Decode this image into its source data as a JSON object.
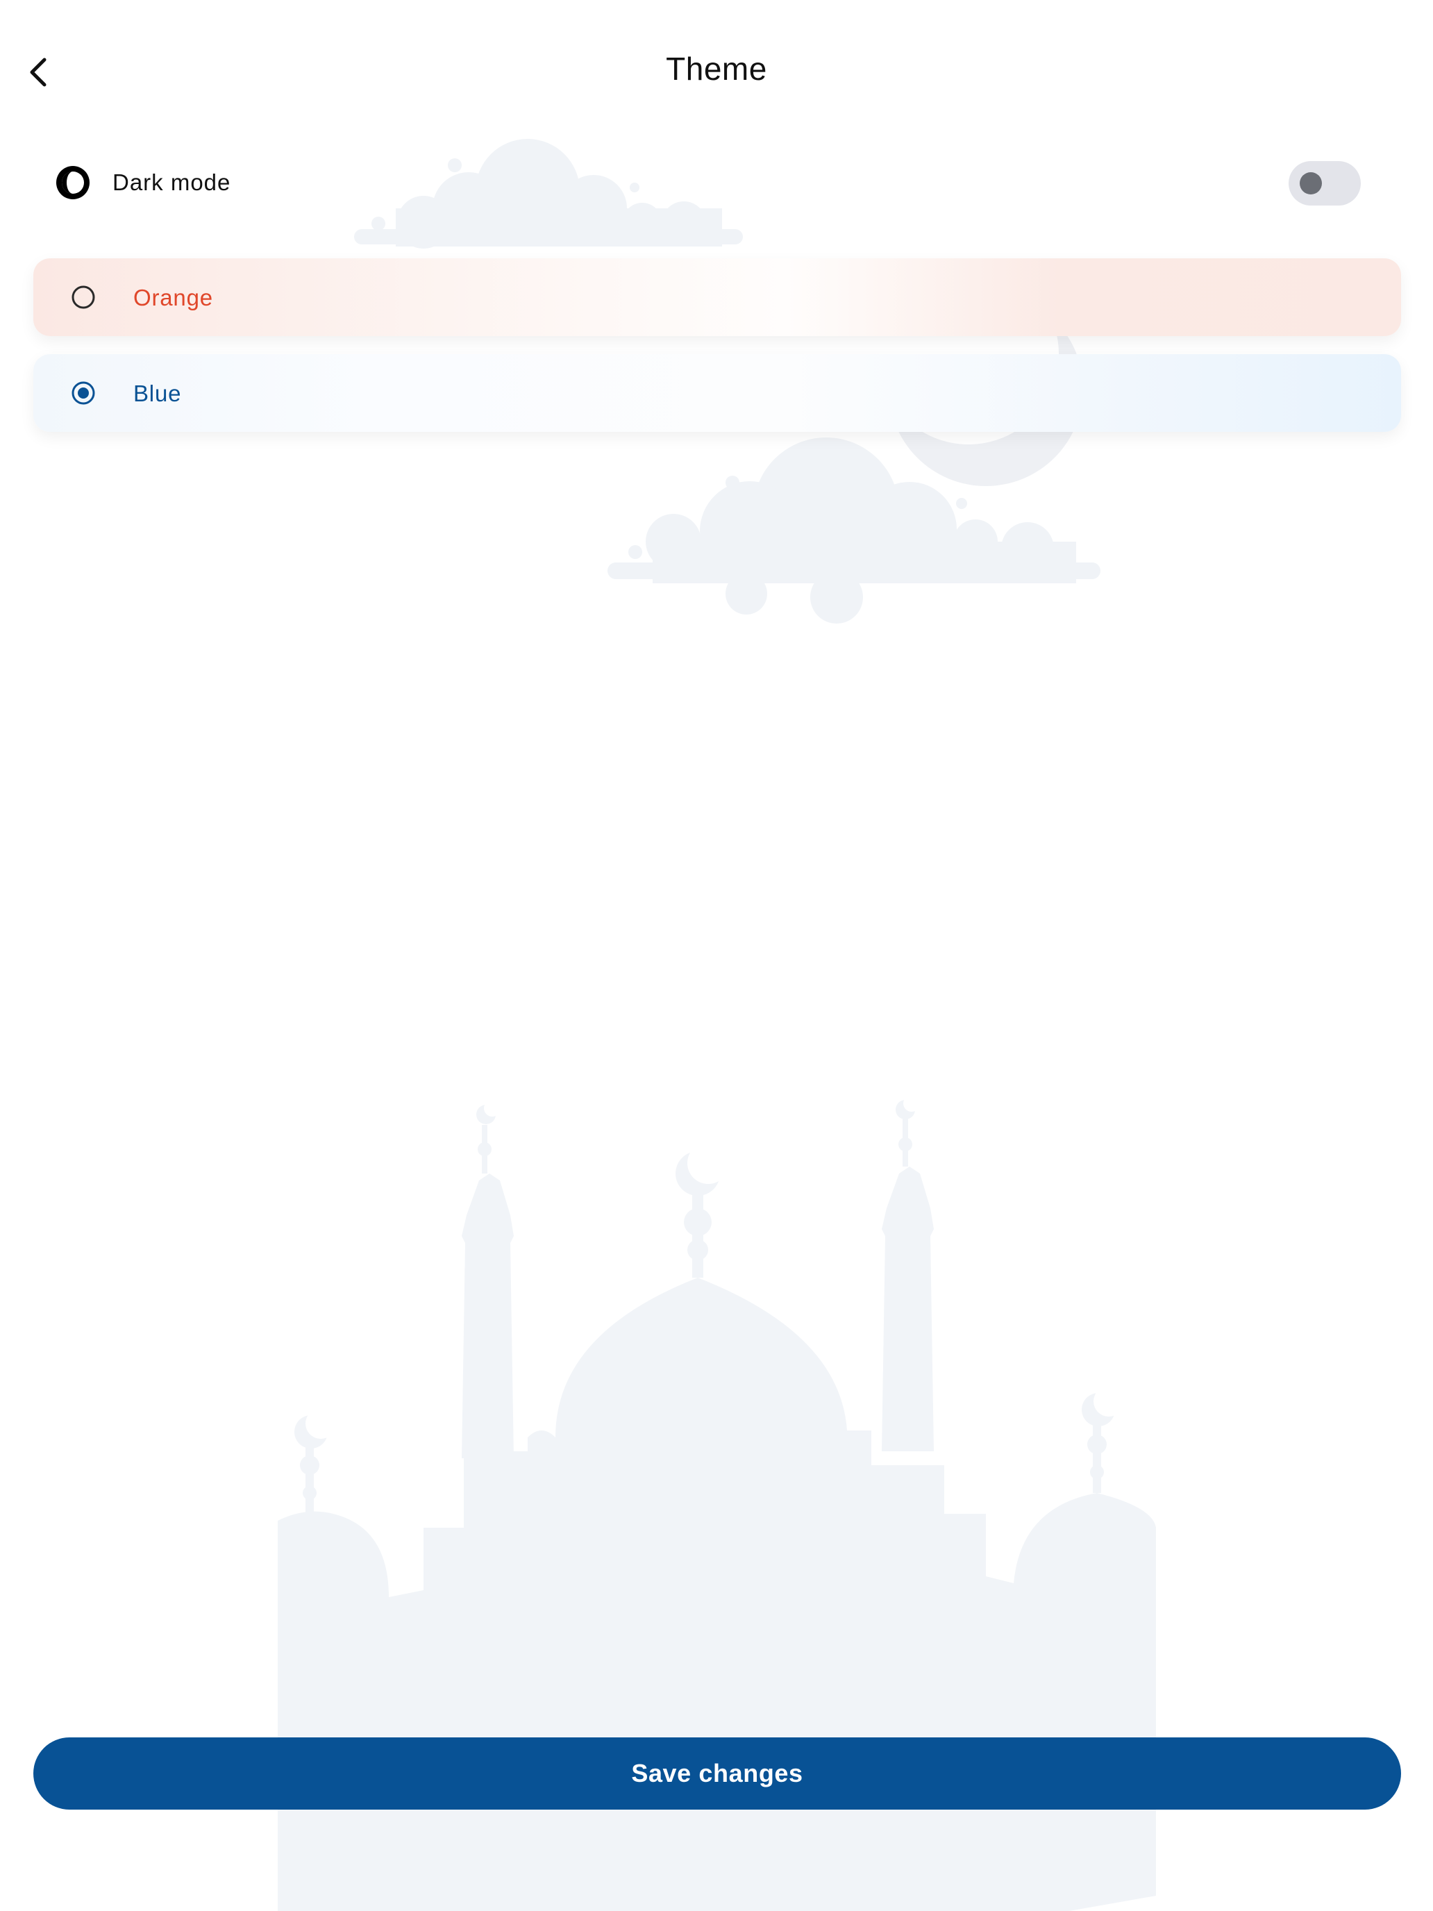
{
  "header": {
    "title": "Theme",
    "back_icon": "chevron-left-icon"
  },
  "dark_mode": {
    "label": "Dark mode",
    "icon": "contrast-icon",
    "enabled": false
  },
  "themes": [
    {
      "label": "Orange",
      "selected": false,
      "color": "#e0472a"
    },
    {
      "label": "Blue",
      "selected": true,
      "color": "#0a5294"
    }
  ],
  "save_button": {
    "label": "Save changes",
    "color": "#085295"
  },
  "colors": {
    "background_art": "#eef2f6"
  }
}
